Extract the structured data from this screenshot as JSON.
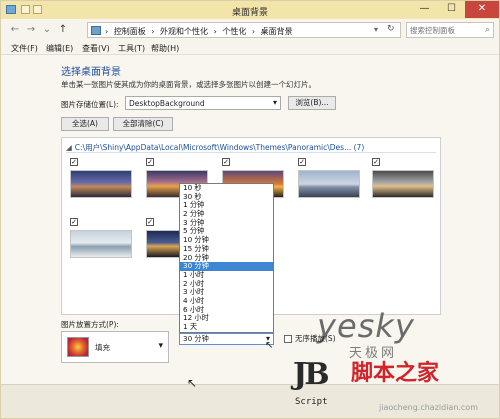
{
  "window": {
    "title": "桌面背景",
    "controls": {
      "minimize": "—",
      "maximize": "☐",
      "close": "✕"
    }
  },
  "nav": {
    "back": "←",
    "forward": "→",
    "recent": "⌄",
    "up": "↑",
    "breadcrumb": [
      "控制面板",
      "外观和个性化",
      "个性化",
      "桌面背景"
    ],
    "breadcrumb_separator": "›",
    "search_placeholder": "搜索控制面板"
  },
  "menubar": {
    "file": "文件(F)",
    "edit": "编辑(E)",
    "view": "查看(V)",
    "tools": "工具(T)",
    "help": "帮助(H)"
  },
  "main": {
    "heading": "选择桌面背景",
    "subtext": "单击某一张图片使其成为你的桌面背景，或选择多张图片以创建一个幻灯片。",
    "location_label": "图片存储位置(L):",
    "location_value": "DesktopBackground",
    "browse_label": "浏览(B)...",
    "select_all_label": "全选(A)",
    "clear_all_label": "全部清除(C)"
  },
  "gallery": {
    "path": "C:\\用户\\Shiny\\AppData\\Local\\Microsoft\\Windows\\Themes\\Panoramic\\Des...",
    "count": "(7)",
    "collapse_glyph": "◢",
    "check_glyph": "✓",
    "thumbnails": [
      {
        "checked": true
      },
      {
        "checked": true
      },
      {
        "checked": true
      },
      {
        "checked": true
      },
      {
        "checked": true
      },
      {
        "checked": true
      },
      {
        "checked": true
      }
    ]
  },
  "interval": {
    "options": [
      "10 秒",
      "30 秒",
      "1 分钟",
      "2 分钟",
      "3 分钟",
      "5 分钟",
      "10 分钟",
      "15 分钟",
      "20 分钟",
      "30 分钟",
      "1 小时",
      "2 小时",
      "3 小时",
      "4 小时",
      "6 小时",
      "12 小时",
      "1 天"
    ],
    "selected": "30 分钟",
    "highlighted_index": 9
  },
  "position": {
    "label": "图片放置方式(P):",
    "value": "填充"
  },
  "shuffle_label": "无序播放(S)",
  "watermark": {
    "main": "yesky",
    "sub": "天极网"
  },
  "logo": {
    "mark": "JB",
    "name": "脚本之家",
    "script": "Script",
    "url": "jiaocheng.chazidian.com"
  },
  "icons": {
    "dropdown": "▾",
    "search": "⌕",
    "refresh": "↻",
    "cursor": "↖"
  }
}
